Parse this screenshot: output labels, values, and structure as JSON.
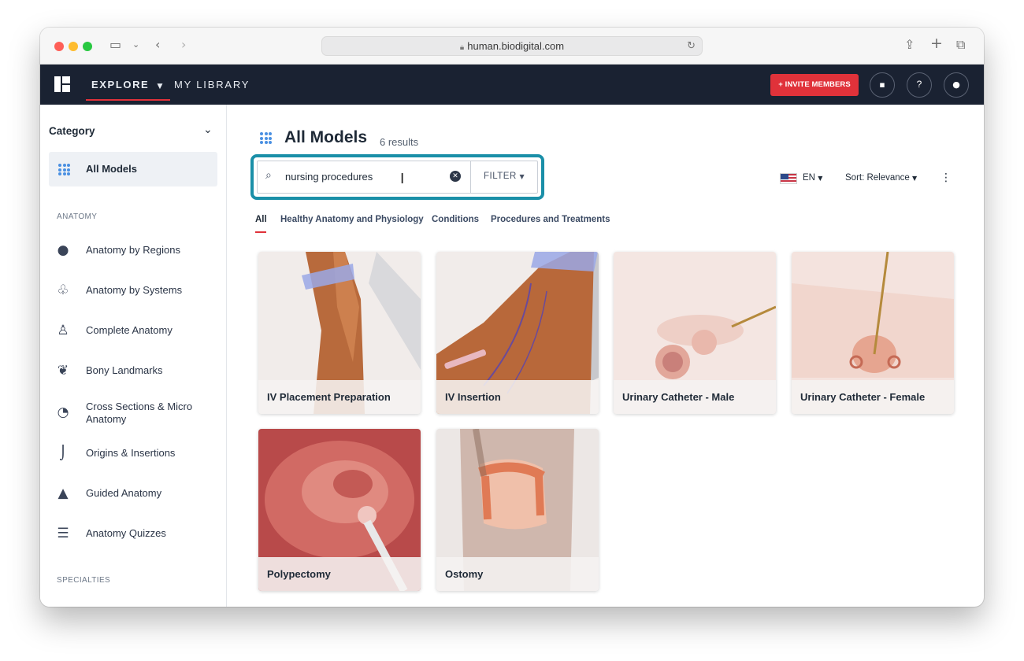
{
  "browser": {
    "url": "human.biodigital.com"
  },
  "appbar": {
    "nav": [
      {
        "label": "EXPLORE"
      },
      {
        "label": "MY LIBRARY"
      }
    ],
    "invite_label": "+ INVITE MEMBERS",
    "help_label": "?"
  },
  "sidebar": {
    "category_label": "Category",
    "all_models_label": "All Models",
    "anatomy_section": "ANATOMY",
    "specialties_section": "SPECIALTIES",
    "items": [
      {
        "label": "Anatomy by Regions",
        "icon": "head-icon"
      },
      {
        "label": "Anatomy by Systems",
        "icon": "lungs-icon"
      },
      {
        "label": "Complete Anatomy",
        "icon": "human-figure-icon"
      },
      {
        "label": "Bony Landmarks",
        "icon": "bone-icon"
      },
      {
        "label": "Cross Sections & Micro Anatomy",
        "icon": "kidney-icon"
      },
      {
        "label": "Origins & Insertions",
        "icon": "leg-icon"
      },
      {
        "label": "Guided Anatomy",
        "icon": "graduation-cap-icon"
      },
      {
        "label": "Anatomy Quizzes",
        "icon": "checklist-icon"
      }
    ]
  },
  "main": {
    "title": "All Models",
    "results": "6 results",
    "search": {
      "value": "nursing procedures",
      "filter_label": "FILTER"
    },
    "language": "EN",
    "sort_label": "Sort: Relevance",
    "tabs": [
      {
        "label": "All"
      },
      {
        "label": "Healthy Anatomy and Physiology"
      },
      {
        "label": "Conditions"
      },
      {
        "label": "Procedures and Treatments"
      }
    ],
    "cards": [
      {
        "title": "IV Placement Preparation"
      },
      {
        "title": "IV Insertion"
      },
      {
        "title": "Urinary Catheter - Male"
      },
      {
        "title": "Urinary Catheter - Female"
      },
      {
        "title": "Polypectomy"
      },
      {
        "title": "Ostomy"
      }
    ]
  },
  "colors": {
    "accent_red": "#e0323a",
    "header_bg": "#1a2232",
    "highlight_teal": "#1a8fa8"
  }
}
